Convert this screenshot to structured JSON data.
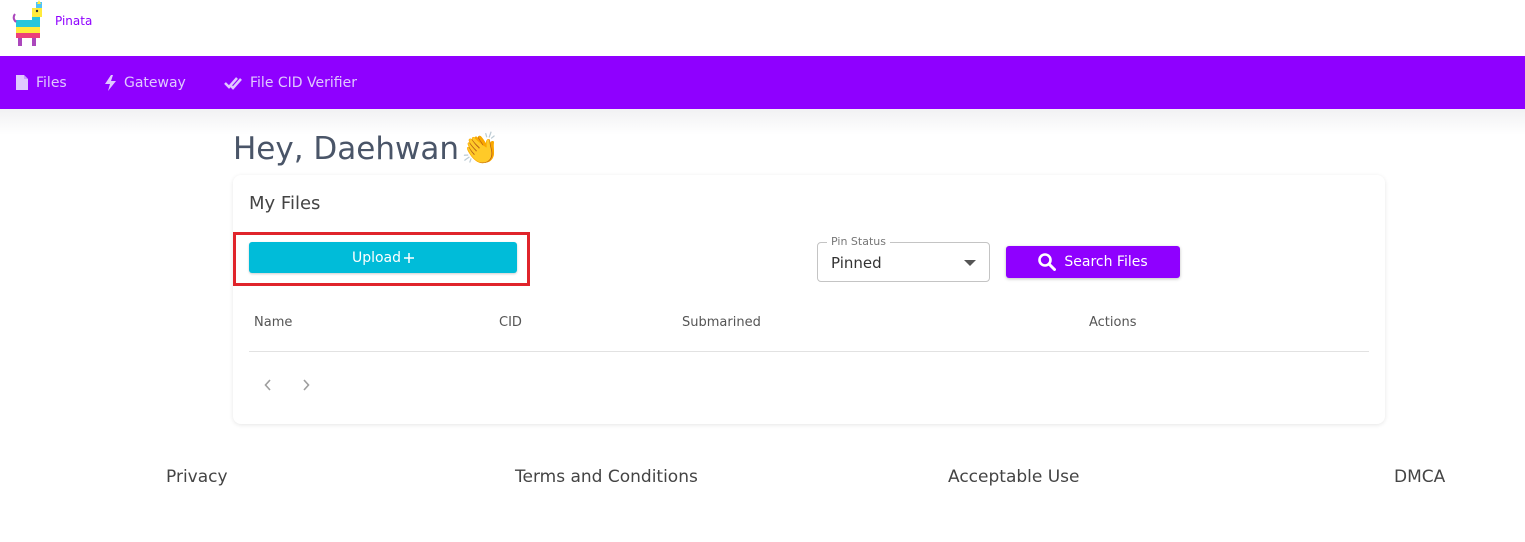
{
  "brand": {
    "name": "Pinata",
    "color": "#8f00ff"
  },
  "nav": {
    "background": "#8f00ff",
    "items": [
      {
        "label": "Files",
        "icon": "file-icon"
      },
      {
        "label": "Gateway",
        "icon": "lightning-icon"
      },
      {
        "label": "File CID Verifier",
        "icon": "double-check-icon"
      }
    ]
  },
  "greeting": {
    "text": "Hey, Daehwan",
    "emoji": "👏"
  },
  "files_card": {
    "title": "My Files",
    "upload_label": "Upload",
    "upload_icon": "plus-icon",
    "upload_color": "#00bcd9",
    "pin_status": {
      "legend": "Pin Status",
      "value": "Pinned"
    },
    "search_label": "Search Files",
    "search_icon": "search-icon",
    "columns": [
      "Name",
      "CID",
      "Submarined",
      "Actions"
    ],
    "rows": [],
    "pagination": {
      "prev_icon": "chevron-left-icon",
      "next_icon": "chevron-right-icon"
    }
  },
  "highlight_color": "#e0242b",
  "footer": {
    "links": [
      "Privacy",
      "Terms and Conditions",
      "Acceptable Use",
      "DMCA"
    ]
  }
}
